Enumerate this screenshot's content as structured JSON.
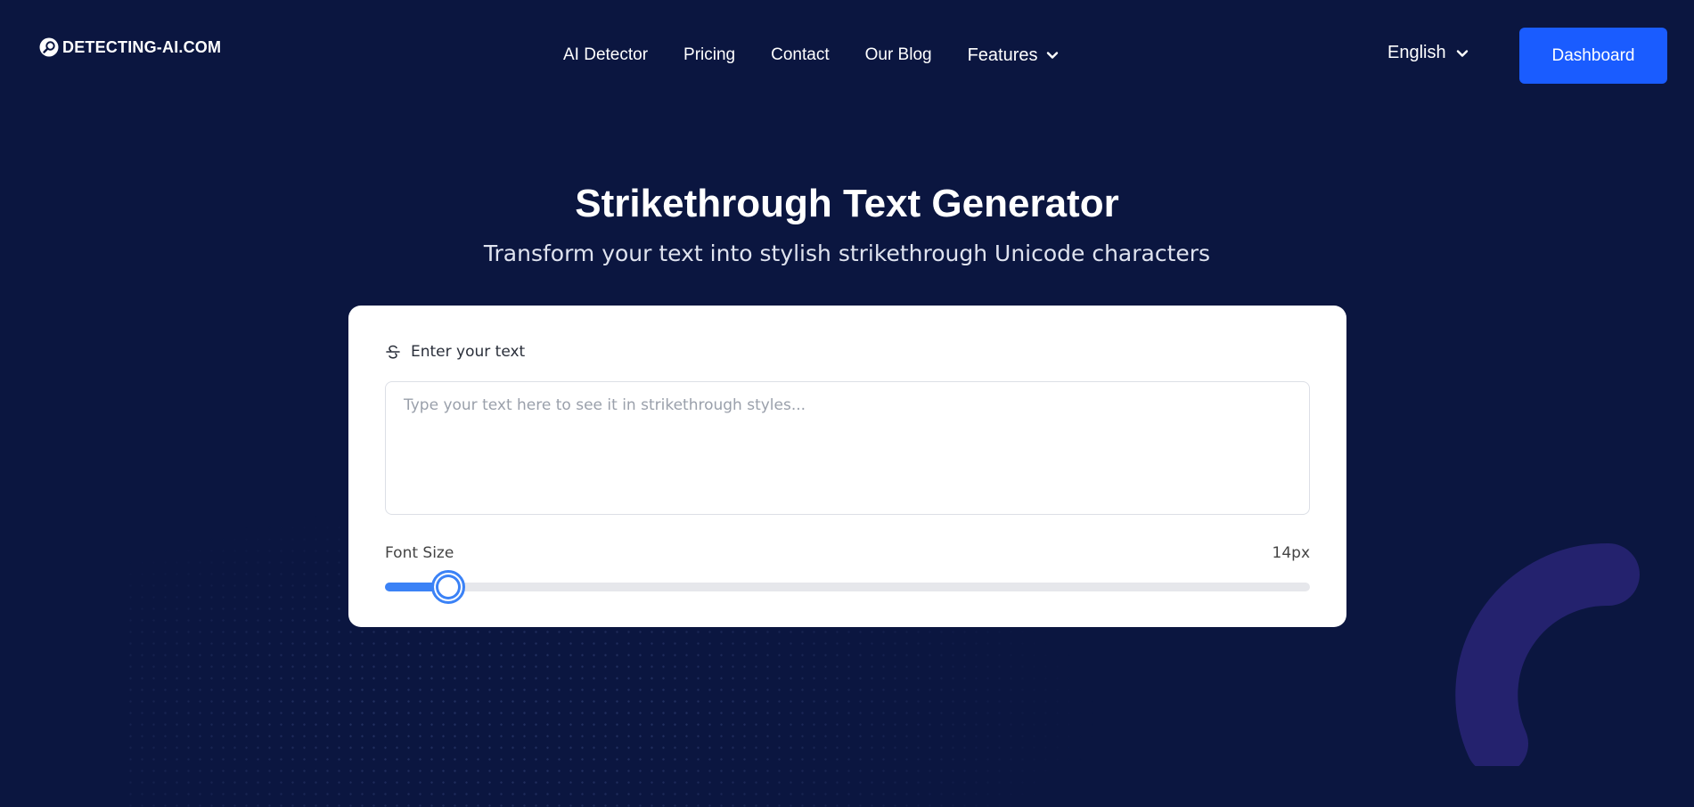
{
  "header": {
    "logo_text": "DETECTING-AI.COM",
    "nav": [
      "AI Detector",
      "Pricing",
      "Contact",
      "Our Blog"
    ],
    "features_label": "Features",
    "language": "English",
    "dashboard_label": "Dashboard"
  },
  "hero": {
    "title": "Strikethrough Text Generator",
    "subtitle": "Transform your text into stylish strikethrough Unicode characters"
  },
  "generator": {
    "input_label": "Enter your text",
    "input_value": "",
    "input_placeholder": "Type your text here to see it in strikethrough styles...",
    "font_size_label": "Font Size",
    "font_size_value": "14px",
    "font_size_fraction": 0.068
  },
  "icons": {
    "logo": "magnifier-logo-icon",
    "features": "chevron-down-icon",
    "language": "chevron-down-icon",
    "input_label": "strikethrough-icon"
  },
  "colors": {
    "background": "#0b1640",
    "accent": "#1a5cff",
    "slider": "#3b82f6",
    "decor_arc": "#24226e"
  }
}
